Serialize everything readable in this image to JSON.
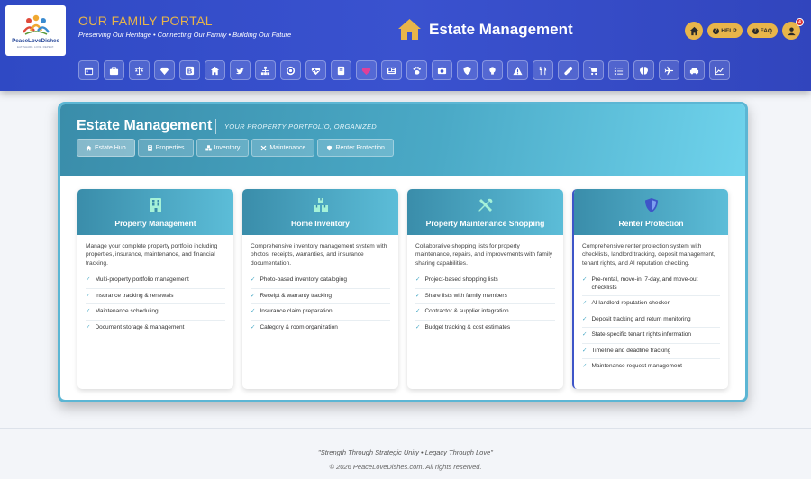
{
  "header": {
    "logo_text": "PeaceLoveDishes",
    "logo_sub": "EAT. SHARE. LOVE. REPEAT.",
    "portal_title": "OUR FAMILY PORTAL",
    "tagline": "Preserving Our Heritage • Connecting Our Family • Building Our Future",
    "page_heading": "Estate Management",
    "help_label": "HELP",
    "faq_label": "FAQ",
    "notification_count": "4",
    "accent_color": "#e8b54a"
  },
  "nav_icons": [
    "calendar-icon",
    "briefcase-icon",
    "scales-icon",
    "gem-icon",
    "blog-icon",
    "home-icon",
    "twitter-icon",
    "sitemap-icon",
    "target-icon",
    "heart-pulse-icon",
    "book-icon",
    "heart-icon",
    "newspaper-icon",
    "paw-icon",
    "camera-icon",
    "shield-icon",
    "lightbulb-icon",
    "warning-icon",
    "utensils-icon",
    "wrench-icon",
    "cart-icon",
    "checklist-icon",
    "brain-icon",
    "plane-icon",
    "car-icon",
    "chart-icon"
  ],
  "panel": {
    "title": "Estate Management",
    "subtitle": "YOUR PROPERTY PORTFOLIO, ORGANIZED",
    "tabs": [
      {
        "label": "Estate Hub"
      },
      {
        "label": "Properties"
      },
      {
        "label": "Inventory"
      },
      {
        "label": "Maintenance"
      },
      {
        "label": "Renter Protection"
      }
    ]
  },
  "cards": [
    {
      "title": "Property Management",
      "icon": "building-icon",
      "description": "Manage your complete property portfolio including properties, insurance, maintenance, and financial tracking.",
      "features": [
        "Multi-property portfolio management",
        "Insurance tracking & renewals",
        "Maintenance scheduling",
        "Document storage & management"
      ]
    },
    {
      "title": "Home Inventory",
      "icon": "boxes-icon",
      "description": "Comprehensive inventory management system with photos, receipts, warranties, and insurance documentation.",
      "features": [
        "Photo-based inventory cataloging",
        "Receipt & warranty tracking",
        "Insurance claim preparation",
        "Category & room organization"
      ]
    },
    {
      "title": "Property Maintenance Shopping",
      "icon": "tools-icon",
      "description": "Collaborative shopping lists for property maintenance, repairs, and improvements with family sharing capabilities.",
      "features": [
        "Project-based shopping lists",
        "Share lists with family members",
        "Contractor & supplier integration",
        "Budget tracking & cost estimates"
      ]
    },
    {
      "title": "Renter Protection",
      "icon": "shield-icon",
      "description": "Comprehensive renter protection system with checklists, landlord tracking, deposit management, tenant rights, and AI reputation checking.",
      "features": [
        "Pre-rental, move-in, 7-day, and move-out checklists",
        "AI landlord reputation checker",
        "Deposit tracking and return monitoring",
        "State-specific tenant rights information",
        "Timeline and deadline tracking",
        "Maintenance request management"
      ]
    }
  ],
  "footer": {
    "quote": "\"Strength Through Strategic Unity • Legacy Through Love\"",
    "copyright": "© 2026 PeaceLoveDishes.com. All rights reserved."
  }
}
